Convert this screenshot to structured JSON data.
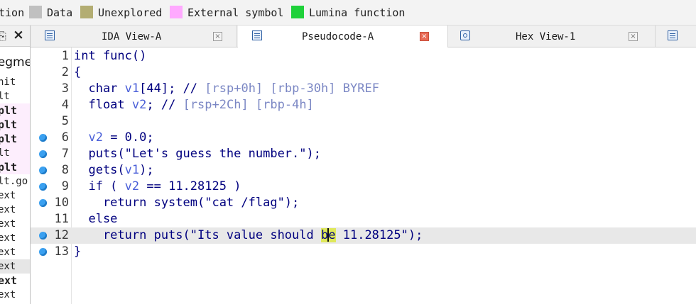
{
  "legend": [
    {
      "label": "tion",
      "color": ""
    },
    {
      "label": "Data",
      "color": "#c0c0c0"
    },
    {
      "label": "Unexplored",
      "color": "#b3ad72"
    },
    {
      "label": "External symbol",
      "color": "#ffa9ff"
    },
    {
      "label": "Lumina function",
      "color": "#1fd13a"
    }
  ],
  "left_panel": {
    "column_header": "Segme",
    "rows": [
      "nit",
      "lt",
      "plt",
      "plt",
      "plt",
      "lt",
      "plt",
      "lt.go",
      "ext",
      "ext",
      "ext",
      "ext",
      "ext",
      "ext",
      "ext",
      "ext"
    ]
  },
  "tabs": [
    {
      "label": "IDA View-A",
      "icon": "ida-view-icon",
      "active": false
    },
    {
      "label": "Pseudocode-A",
      "icon": "pseudocode-icon",
      "active": true
    },
    {
      "label": "Hex View-1",
      "icon": "hex-view-icon",
      "active": false
    },
    {
      "label": "",
      "icon": "structures-icon",
      "active": false
    }
  ],
  "code": {
    "line_numbers": [
      "1",
      "2",
      "3",
      "4",
      "5",
      "6",
      "7",
      "8",
      "9",
      "10",
      "11",
      "12",
      "13"
    ],
    "lines": [
      "int func()",
      "{",
      "  char v1[44]; // [rsp+0h] [rbp-30h] BYREF",
      "  float v2; // [rsp+2Ch] [rbp-4h]",
      "",
      "  v2 = 0.0;",
      "  puts(\"Let's guess the number.\");",
      "  gets(v1);",
      "  if ( v2 == 11.28125 )",
      "    return system(\"cat /flag\");",
      "  else",
      "    return puts(\"Its value should be 11.28125\");",
      "}"
    ],
    "breakpoint_lines": [
      "6",
      "7",
      "8",
      "9",
      "10",
      "12",
      "13"
    ],
    "current_line": "12",
    "highlight_word": "be"
  },
  "colors": {
    "code_text": "#00007f",
    "variable": "#4a5fd8",
    "comment": "#7b87c4",
    "current_line_bg": "#e8e8e8",
    "word_highlight": "#dfe85a",
    "breakpoint_dot": "#3aa0f0"
  }
}
